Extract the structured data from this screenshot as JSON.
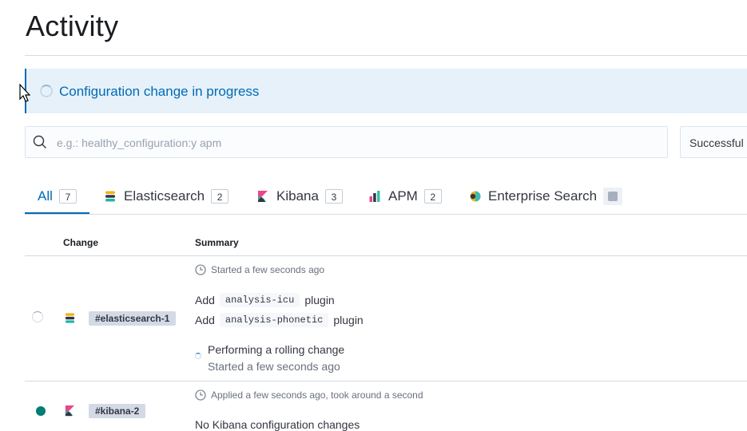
{
  "page": {
    "title": "Activity"
  },
  "callout": {
    "text": "Configuration change in progress"
  },
  "search": {
    "placeholder": "e.g.: healthy_configuration:y apm"
  },
  "filter": {
    "label": "Successful"
  },
  "tabs": [
    {
      "label": "All",
      "count": "7",
      "active": true
    },
    {
      "label": "Elasticsearch",
      "count": "2"
    },
    {
      "label": "Kibana",
      "count": "3"
    },
    {
      "label": "APM",
      "count": "2"
    },
    {
      "label": "Enterprise Search",
      "count": ""
    }
  ],
  "table": {
    "headers": {
      "change": "Change",
      "summary": "Summary"
    },
    "rows": [
      {
        "status": "in-progress",
        "product": "Elasticsearch",
        "badge": "#elasticsearch-1",
        "meta": "Started a few seconds ago",
        "lines": [
          {
            "pre": "Add",
            "code": "analysis-icu",
            "post": "plugin"
          },
          {
            "pre": "Add",
            "code": "analysis-phonetic",
            "post": "plugin"
          }
        ],
        "step": {
          "title": "Performing a rolling change",
          "subtitle": "Started a few seconds ago"
        }
      },
      {
        "status": "success",
        "product": "Kibana",
        "badge": "#kibana-2",
        "meta": "Applied a few seconds ago, took around a second",
        "note": "No Kibana configuration changes"
      }
    ]
  },
  "colors": {
    "accent": "#006bb4",
    "success": "#017d73",
    "callout_bg": "#e6f1fa"
  },
  "icons": [
    "spinner-icon",
    "search-icon",
    "elasticsearch-logo-icon",
    "kibana-logo-icon",
    "apm-logo-icon",
    "enterprise-search-logo-icon",
    "clock-icon"
  ]
}
